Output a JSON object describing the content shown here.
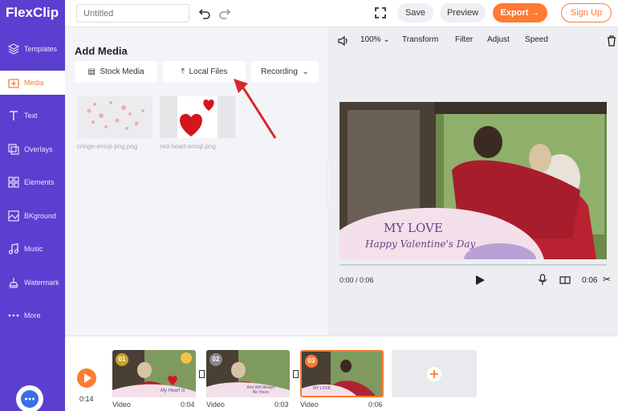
{
  "app": {
    "logo": "FlexClip",
    "title_placeholder": "Untitled"
  },
  "toolbar": {
    "save": "Save",
    "preview": "Preview",
    "export": "Export",
    "signup": "Sign Up"
  },
  "sidebar": {
    "items": [
      {
        "label": "Templates",
        "icon": "templates-icon"
      },
      {
        "label": "Media",
        "icon": "media-icon"
      },
      {
        "label": "Text",
        "icon": "text-icon"
      },
      {
        "label": "Overlays",
        "icon": "overlays-icon"
      },
      {
        "label": "Elements",
        "icon": "elements-icon"
      },
      {
        "label": "BKground",
        "icon": "background-icon"
      },
      {
        "label": "Music",
        "icon": "music-icon"
      },
      {
        "label": "Watermark",
        "icon": "watermark-icon"
      },
      {
        "label": "More",
        "icon": "more-icon"
      }
    ]
  },
  "media": {
    "title": "Add Media",
    "tabs": {
      "stock": "Stock Media",
      "local": "Local Files",
      "recording": "Recording"
    },
    "files": [
      {
        "name": "cringe-emoji-png.png"
      },
      {
        "name": "red-heart-emoji.png"
      }
    ]
  },
  "preview": {
    "zoom": "100%",
    "tools": {
      "transform": "Transform",
      "filter": "Filter",
      "adjust": "Adjust",
      "speed": "Speed"
    },
    "overlay_title": "MY LOVE",
    "overlay_subtitle": "Happy Valentine's Day",
    "time_current": "0:00 / 0:06",
    "duration": "0:06"
  },
  "timeline": {
    "current": "0:14",
    "clips": [
      {
        "badge": "01",
        "type": "Video",
        "duration": "0:04",
        "caption": "My Heart Is"
      },
      {
        "badge": "02",
        "type": "Video",
        "duration": "0:03",
        "caption": "And Will Always Be Yours"
      },
      {
        "badge": "03",
        "type": "Video",
        "duration": "0:06",
        "caption": "MY LOVE"
      }
    ]
  },
  "colors": {
    "brand": "#5b3fd0",
    "accent": "#ff7a32"
  }
}
